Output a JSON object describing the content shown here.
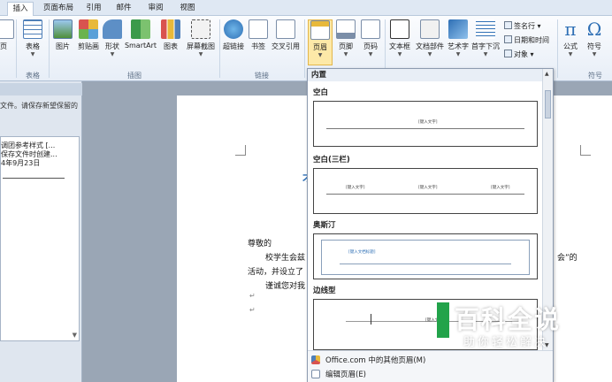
{
  "tabs": [
    "插入",
    "页面布局",
    "引用",
    "邮件",
    "审阅",
    "视图"
  ],
  "active_tab": "插入",
  "ribbon": {
    "cut_button": "页",
    "table_button": "表格",
    "picture_button": "图片",
    "clipart_button": "剪贴画",
    "shapes_button": "形状",
    "smartart_button": "SmartArt",
    "chart_button": "图表",
    "screenshot_button": "屏幕截图",
    "hyperlink_button": "超链接",
    "bookmark_button": "书签",
    "crossref_button": "交叉引用",
    "header_button": "页眉",
    "footer_button": "页脚",
    "pagenum_button": "页码",
    "textbox_button": "文本框",
    "quickparts_button": "文档部件",
    "wordart_button": "艺术字",
    "dropcap_button": "首字下沉",
    "signature_line": "签名行",
    "datetime": "日期和时间",
    "object": "对象",
    "equation_button": "公式",
    "symbol_button": "符号",
    "group_tables": "表格",
    "group_illustrations": "插图",
    "group_links": "链接",
    "group_symbols": "符号"
  },
  "navpane": {
    "note": "文件。请保存新望保留的",
    "items": [
      "调团参考样式 [...",
      "保存文件时创建...",
      "4年9月23日"
    ]
  },
  "document": {
    "line1_left": "尊敬的",
    "line1_mid": "《",
    "line2": "校学生会兹",
    "line2_right": "会”的",
    "line3": "活动，并设立了",
    "line4": "谨诚您对我",
    "blue_glyph": "才",
    "para_mark": "↵"
  },
  "gallery": {
    "title": "内置",
    "templates": [
      {
        "name": "空白",
        "placeholders": [
          "[键入文字]"
        ]
      },
      {
        "name": "空白(三栏)",
        "placeholders": [
          "[键入文字]",
          "[键入文字]",
          "[键入文字]"
        ]
      },
      {
        "name": "奥斯汀",
        "placeholders": [
          "[键入文档标题]"
        ]
      },
      {
        "name": "边线型",
        "placeholders": [
          "[键入文"
        ]
      }
    ],
    "more_item": "Office.com 中的其他页眉(M)",
    "edit_item": "编辑页眉(E)"
  },
  "watermark": {
    "title": "百科全说",
    "subtitle": "助你轻松解决"
  },
  "colors": {
    "ribbon_bg": "#e7eef7",
    "pressed": "#fde9a8",
    "accent_blue": "#2e6fb5",
    "watermark_green": "#22a34a"
  }
}
